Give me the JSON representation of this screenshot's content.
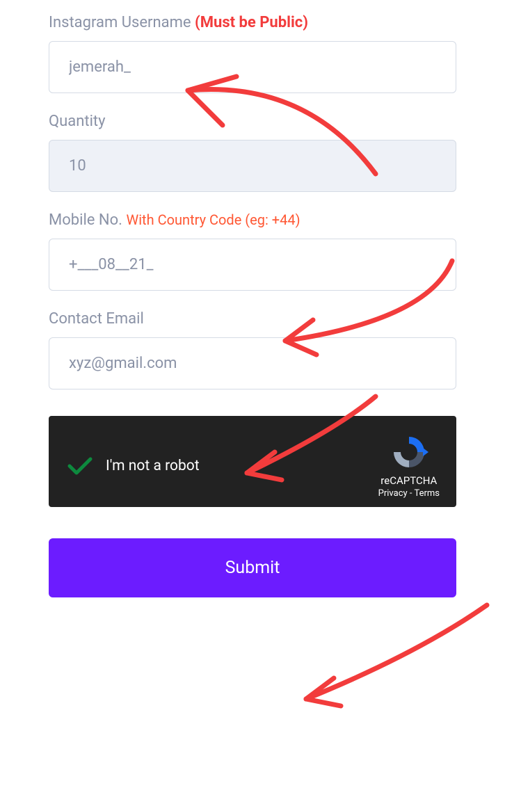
{
  "fields": {
    "username": {
      "label_main": "Instagram Username",
      "label_accent": "(Must be Public)",
      "value": "jemerah_"
    },
    "quantity": {
      "label": "Quantity",
      "value": "10"
    },
    "mobile": {
      "label_main": "Mobile No.",
      "label_accent": "With Country Code (eg: +44)",
      "value": "+___08__21_"
    },
    "email": {
      "label": "Contact Email",
      "value": "xyz@gmail.com"
    }
  },
  "recaptcha": {
    "text": "I'm not a robot",
    "brand": "reCAPTCHA",
    "privacy": "Privacy",
    "separator": " - ",
    "terms": "Terms"
  },
  "submit": {
    "label": "Submit"
  }
}
